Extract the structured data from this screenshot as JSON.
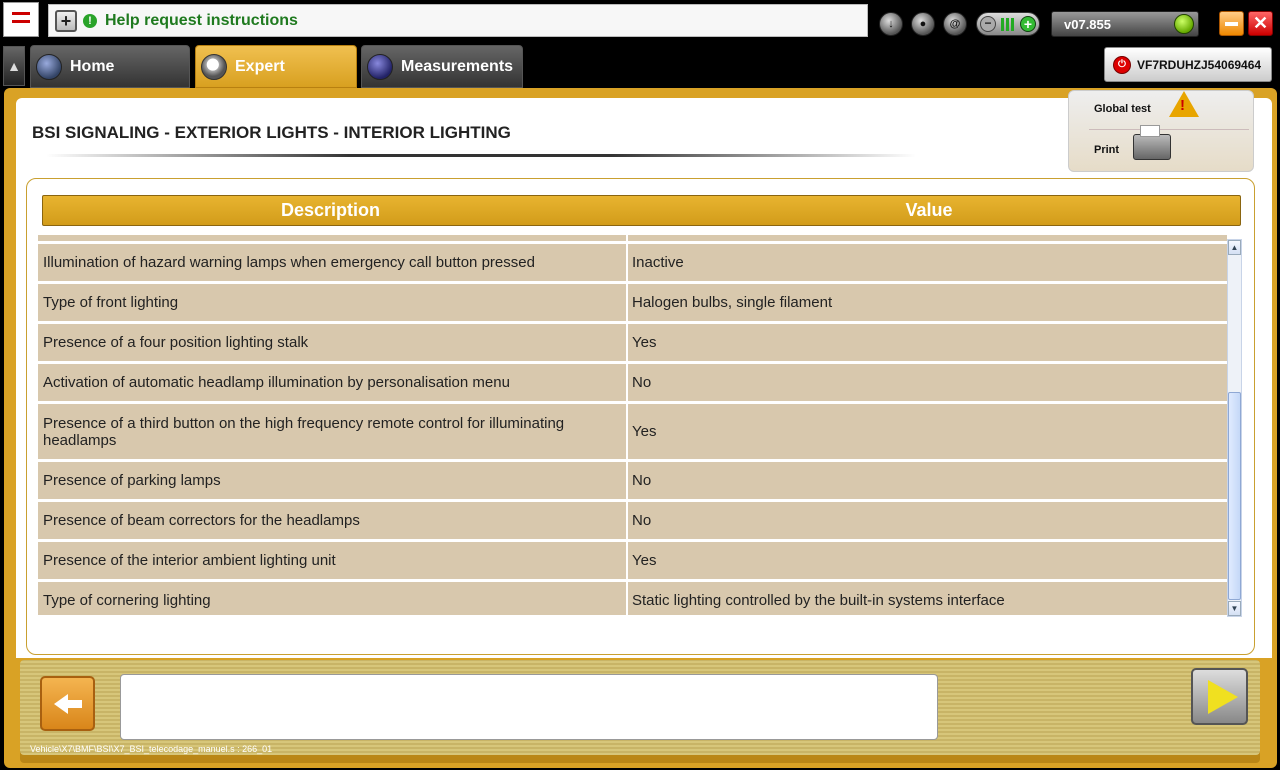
{
  "topbar": {
    "help_text": "Help request instructions",
    "version": "v07.855"
  },
  "tabs": [
    {
      "label": "Home"
    },
    {
      "label": "Expert"
    },
    {
      "label": "Measurements"
    }
  ],
  "vin": "VF7RDUHZJ54069464",
  "page": {
    "title": "BSI  SIGNALING - EXTERIOR LIGHTS - INTERIOR LIGHTING",
    "actions": {
      "global_test": "Global test",
      "print": "Print"
    }
  },
  "table": {
    "headers": {
      "description": "Description",
      "value": "Value"
    },
    "rows": [
      {
        "description": "Illumination of hazard warning lamps when emergency call button pressed",
        "value": "Inactive"
      },
      {
        "description": "Type of front lighting",
        "value": "Halogen bulbs, single filament"
      },
      {
        "description": "Presence of a four position lighting stalk",
        "value": "Yes"
      },
      {
        "description": "Activation of automatic headlamp illumination by personalisation menu",
        "value": "No"
      },
      {
        "description": "Presence of a third button on the high frequency remote control for illuminating headlamps",
        "value": "Yes"
      },
      {
        "description": "Presence of parking lamps",
        "value": "No"
      },
      {
        "description": "Presence of beam correctors for the headlamps",
        "value": "No"
      },
      {
        "description": "Presence of the interior ambient lighting unit",
        "value": "Yes"
      },
      {
        "description": "Type of cornering lighting",
        "value": "Static lighting controlled by the built-in systems interface"
      }
    ]
  },
  "footer": {
    "path": "Vehicle\\X7\\BMF\\BSI\\X7_BSI_telecodage_manuel.s : 266_01"
  },
  "colors": {
    "accent": "#d9a225",
    "row_bg": "#d8c8ad",
    "help_text": "#1f7a1f"
  }
}
